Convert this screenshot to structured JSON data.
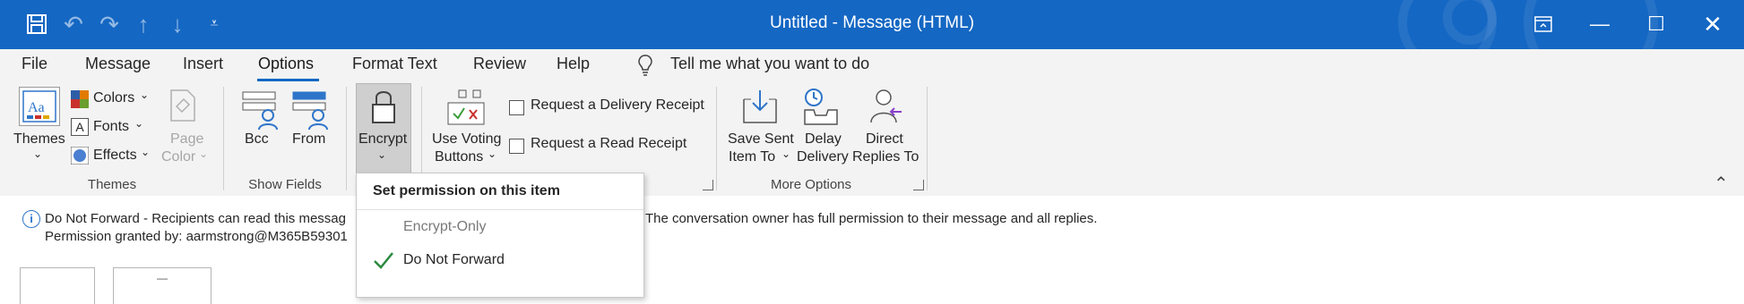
{
  "window": {
    "title": "Untitled  -  Message (HTML)",
    "brand_color": "#1467c3",
    "quick_access_icons": [
      "save-icon",
      "undo-icon",
      "redo-icon",
      "up-arrow-icon",
      "down-arrow-icon",
      "customize-qat-icon"
    ],
    "controls": [
      "restore-ribbon-icon",
      "minimize-icon",
      "maximize-icon",
      "close-icon"
    ]
  },
  "menu": {
    "tabs": [
      "File",
      "Message",
      "Insert",
      "Options",
      "Format Text",
      "Review",
      "Help"
    ],
    "active_tab": "Options",
    "tell_me": "Tell me what you want to do"
  },
  "ribbon": {
    "themes_group": {
      "label": "Themes",
      "themes_button": "Themes",
      "colors": "Colors",
      "fonts": "Fonts",
      "effects": "Effects",
      "page_color_line1": "Page",
      "page_color_line2": "Color"
    },
    "show_fields_group": {
      "label": "Show Fields",
      "bcc": "Bcc",
      "from": "From"
    },
    "encrypt": {
      "label": "Encrypt"
    },
    "tracking": {
      "voting_line1": "Use Voting",
      "voting_line2": "Buttons",
      "delivery_receipt": "Request a Delivery Receipt",
      "read_receipt": "Request a Read Receipt"
    },
    "more_options_group": {
      "label": "More Options",
      "save_sent_line1": "Save Sent",
      "save_sent_line2": "Item To",
      "delay_line1": "Delay",
      "delay_line2": "Delivery",
      "direct_line1": "Direct",
      "direct_line2": "Replies To"
    }
  },
  "info_bar": {
    "line1_left": "Do Not Forward - Recipients can read this messag",
    "line1_right": "The conversation owner has full permission to their message and all replies.",
    "line2": "Permission granted by: aarmstrong@M365B59301"
  },
  "encrypt_dropdown": {
    "header": "Set permission on this item",
    "items": [
      {
        "label": "Encrypt-Only",
        "checked": false
      },
      {
        "label": "Do Not Forward",
        "checked": true
      }
    ]
  }
}
